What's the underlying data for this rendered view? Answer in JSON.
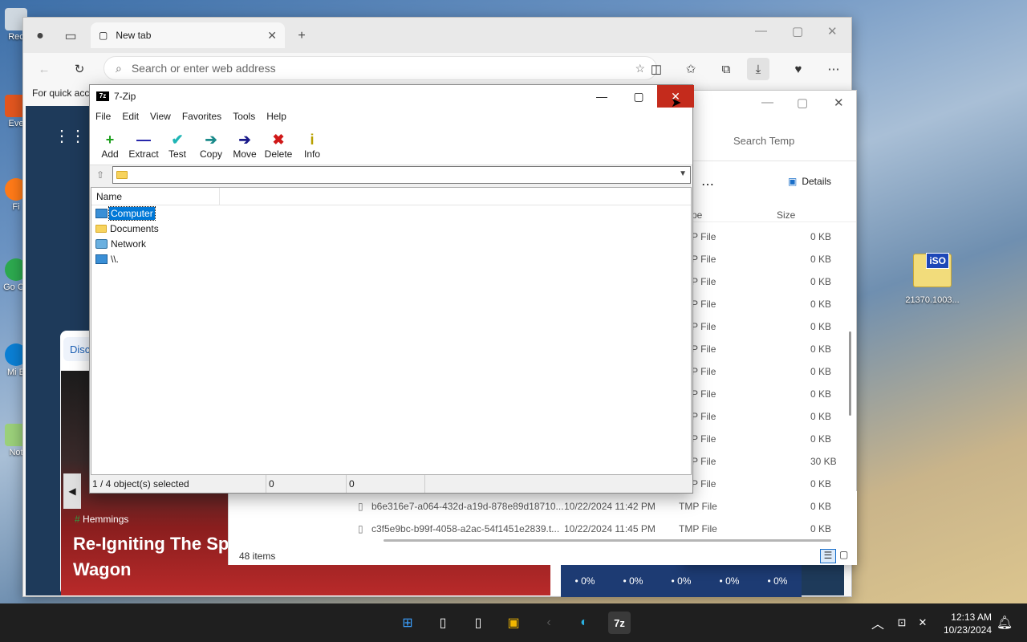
{
  "desktop": {
    "icons": [
      {
        "label": "Rec",
        "name": "recycle-bin"
      },
      {
        "label": "Eve",
        "name": "everything-shortcut"
      },
      {
        "label": "Fi",
        "name": "firefox-shortcut"
      },
      {
        "label": "Go Ch",
        "name": "chrome-shortcut"
      },
      {
        "label": "Mi E",
        "name": "edge-shortcut"
      },
      {
        "label": "Not",
        "name": "notepad-shortcut"
      }
    ],
    "iso_file": "21370.1003...",
    "iso_badge": "iSO"
  },
  "edge": {
    "tab_title": "New tab",
    "address_placeholder": "Search or enter web address",
    "quick_access": "For quick acce",
    "discover": "Disc",
    "news_source": "Hemmings",
    "news_title": "Re-Igniting The Sp Wagon",
    "weather": [
      "• 0%",
      "• 0%",
      "• 0%",
      "• 0%",
      "• 0%"
    ]
  },
  "explorer": {
    "search_placeholder": "Search Temp",
    "details_label": "Details",
    "col_type": "pe",
    "col_size": "Size",
    "rows": [
      {
        "type": "P File",
        "size": "0 KB"
      },
      {
        "type": "P File",
        "size": "0 KB"
      },
      {
        "type": "P File",
        "size": "0 KB"
      },
      {
        "type": "P File",
        "size": "0 KB"
      },
      {
        "type": "P File",
        "size": "0 KB"
      },
      {
        "type": "P File",
        "size": "0 KB"
      },
      {
        "type": "P File",
        "size": "0 KB"
      },
      {
        "type": "P File",
        "size": "0 KB"
      },
      {
        "type": "P File",
        "size": "0 KB"
      },
      {
        "type": "P File",
        "size": "0 KB"
      },
      {
        "type": "P File",
        "size": "30 KB"
      },
      {
        "type": "P File",
        "size": "0 KB"
      }
    ],
    "full_rows": [
      {
        "name": "b6e316e7-a064-432d-a19d-878e89d18710...",
        "date": "10/22/2024 11:42 PM",
        "type": "TMP File",
        "size": "0 KB"
      },
      {
        "name": "c3f5e9bc-b99f-4058-a2ac-54f1451e2839.t...",
        "date": "10/22/2024 11:45 PM",
        "type": "TMP File",
        "size": "0 KB"
      }
    ],
    "item_count": "48 items"
  },
  "sevenzip": {
    "title": "7-Zip",
    "logo": "7z",
    "menu": [
      "File",
      "Edit",
      "View",
      "Favorites",
      "Tools",
      "Help"
    ],
    "tools": [
      {
        "label": "Add",
        "icon": "+",
        "color": "#1ea01e",
        "name": "add-icon"
      },
      {
        "label": "Extract",
        "icon": "—",
        "color": "#1a1aa6",
        "name": "extract-icon"
      },
      {
        "label": "Test",
        "icon": "✔",
        "color": "#1fb5b5",
        "name": "test-icon"
      },
      {
        "label": "Copy",
        "icon": "➔",
        "color": "#1a8a8a",
        "name": "copy-icon"
      },
      {
        "label": "Move",
        "icon": "➔",
        "color": "#1a1a8a",
        "name": "move-icon"
      },
      {
        "label": "Delete",
        "icon": "✖",
        "color": "#d01818",
        "name": "delete-icon"
      },
      {
        "label": "Info",
        "icon": "i",
        "color": "#b8a000",
        "name": "info-icon"
      }
    ],
    "column_name": "Name",
    "items": [
      {
        "label": "Computer",
        "icon": "computer-icon",
        "selected": true
      },
      {
        "label": "Documents",
        "icon": "folder-icon",
        "selected": false
      },
      {
        "label": "Network",
        "icon": "network-icon",
        "selected": false
      },
      {
        "label": "\\\\.",
        "icon": "computer-icon",
        "selected": false
      }
    ],
    "status": {
      "selection": "1 / 4 object(s) selected",
      "size": "0",
      "packed": "0"
    }
  },
  "taskbar": {
    "time": "12:13 AM",
    "date": "10/23/2024"
  }
}
